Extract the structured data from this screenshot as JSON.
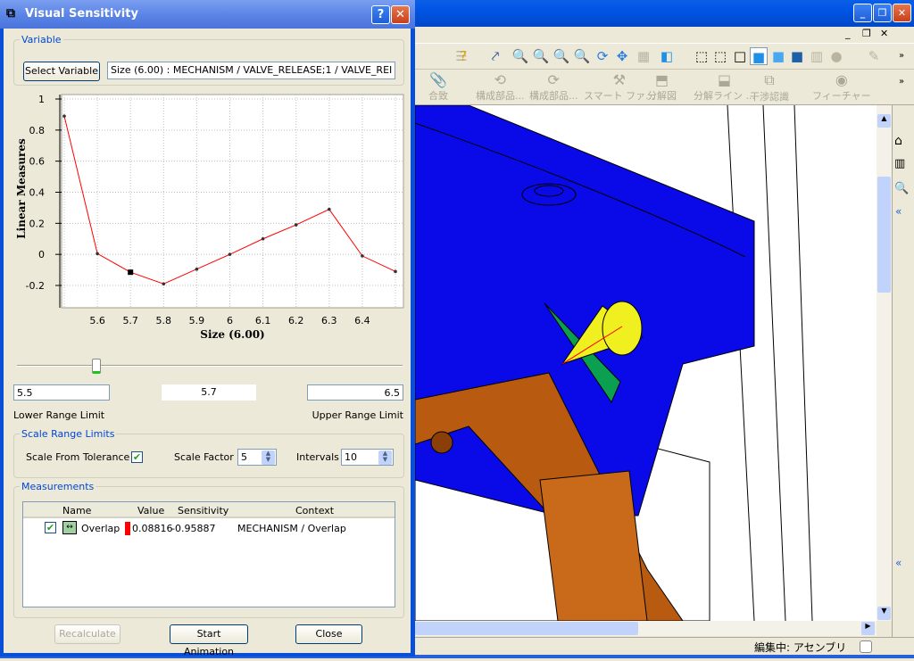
{
  "dialog": {
    "title": "Visual Sensitivity",
    "help_icon": "question-icon",
    "close_icon": "close-icon",
    "variable": {
      "legend": "Variable",
      "select_button": "Select Variable",
      "value": "Size (6.00) :  MECHANISM / VALVE_RELEASE;1 / VALVE_REI"
    },
    "range": {
      "lower_value": "5.5",
      "current_value": "5.7",
      "upper_value": "6.5",
      "lower_label": "Lower Range Limit",
      "upper_label": "Upper Range Limit",
      "slider_fraction": 0.2
    },
    "scale": {
      "legend": "Scale Range Limits",
      "from_tolerance_label": "Scale From Tolerance",
      "from_tolerance_checked": true,
      "factor_label": "Scale Factor",
      "factor_value": "5",
      "intervals_label": "Intervals",
      "intervals_value": "10"
    },
    "measurements": {
      "legend": "Measurements",
      "columns": [
        "Name",
        "Value",
        "Sensitivity",
        "Context"
      ],
      "rows": [
        {
          "checked": true,
          "icon": "linear-measure-icon",
          "name": "Overlap",
          "color": "#ff0000",
          "value": "0.08816",
          "sensitivity": "-0.95887",
          "context": "MECHANISM / Overlap"
        }
      ]
    },
    "buttons": {
      "recalculate": "Recalculate",
      "start_animation": "Start Animation",
      "close": "Close"
    }
  },
  "chart_data": {
    "type": "line",
    "xlabel": "Size (6.00)",
    "ylabel": "Linear Measures",
    "x": [
      5.5,
      5.6,
      5.7,
      5.8,
      5.9,
      6.0,
      6.1,
      6.2,
      6.3,
      6.4,
      6.5
    ],
    "values": [
      0.89,
      0.005,
      -0.115,
      -0.19,
      -0.095,
      0.0,
      0.1,
      0.19,
      0.29,
      -0.01,
      -0.11
    ],
    "selected_x": 5.7,
    "xticks": [
      "5.6",
      "5.7",
      "5.8",
      "5.9",
      "6",
      "6.1",
      "6.2",
      "6.3",
      "6.4"
    ],
    "yticks": [
      "1",
      "0.8",
      "0.6",
      "0.4",
      "0.2",
      "0",
      "-0.2"
    ],
    "xlim": [
      5.5,
      6.5
    ],
    "ylim": [
      -0.3,
      1.0
    ],
    "grid": true,
    "line_color": "#ff0000"
  },
  "app": {
    "toolbar2": [
      "合致",
      "構成部品...",
      "構成部品...",
      "スマート ファ...",
      "分解図",
      "分解ライン ...",
      "干渉認識",
      "フィーチャー"
    ],
    "status": "編集中: アセンブリ"
  }
}
